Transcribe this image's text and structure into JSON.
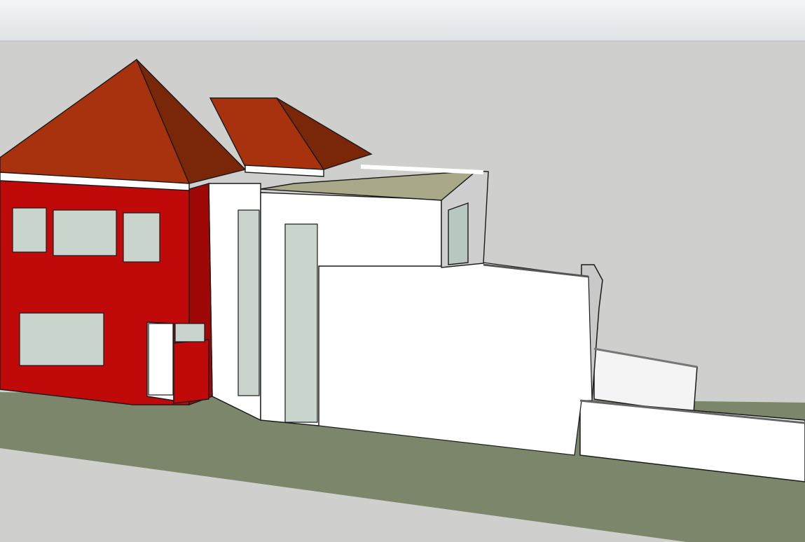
{
  "app": {
    "toolbar": {
      "visible": true
    },
    "viewport": {
      "background_color": "#cfcfcd",
      "ground_color": "#7b866a",
      "roof_color": "#a8320e",
      "roof_shadow_color": "#7a2608",
      "wall_red_color": "#c00a0a",
      "wall_white_color": "#ffffff",
      "edge_color": "#1a1a1a",
      "hidden_edge_style": "dotted",
      "glass_color": "#c8d4cc",
      "model": {
        "objects": [
          "hip-roof-main",
          "hip-roof-secondary",
          "red-house-facade",
          "upper-windows",
          "lower-window",
          "front-door",
          "white-extension",
          "glazed-panels",
          "roof-terrace",
          "stepped-walls",
          "ground-plane"
        ]
      }
    }
  }
}
